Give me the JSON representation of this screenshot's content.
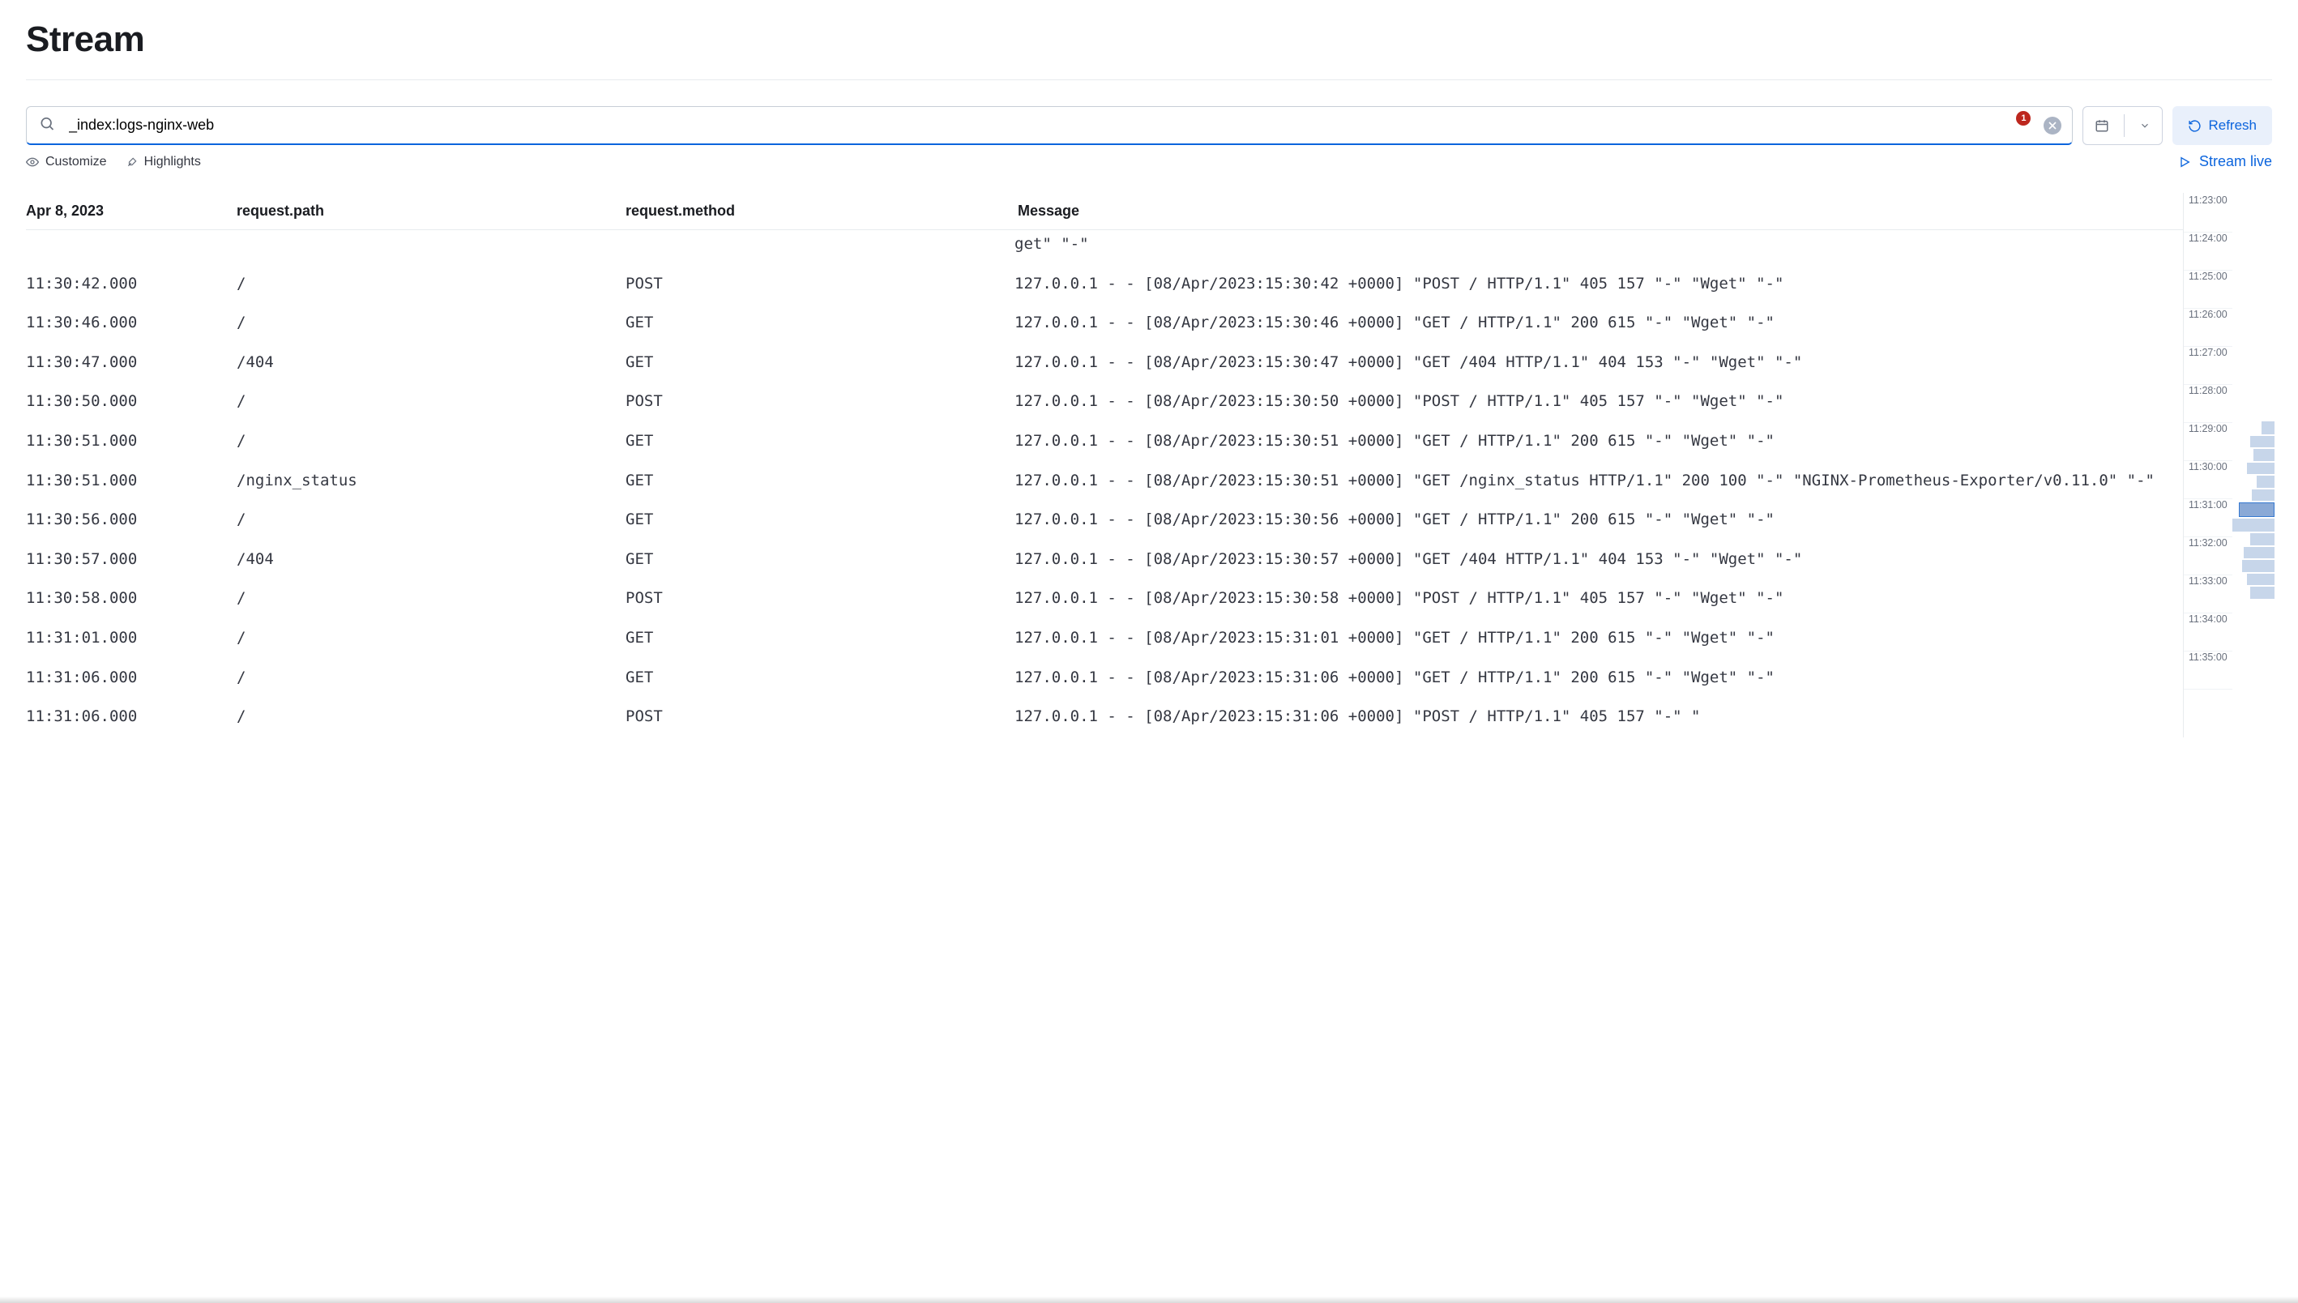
{
  "header": {
    "title": "Stream"
  },
  "search": {
    "value": "_index:logs-nginx-web",
    "badge_count": "1"
  },
  "actions": {
    "refresh_label": "Refresh",
    "customize_label": "Customize",
    "highlights_label": "Highlights",
    "stream_live_label": "Stream live"
  },
  "columns": {
    "date": "Apr 8, 2023",
    "path": "request.path",
    "method": "request.method",
    "message": "Message"
  },
  "rows": [
    {
      "ts": "",
      "path": "",
      "method": "",
      "msg": "get\" \"-\"",
      "cutoff": true
    },
    {
      "ts": "11:30:42.000",
      "path": "/",
      "method": "POST",
      "msg": "127.0.0.1 - - [08/Apr/2023:15:30:42 +0000] \"POST / HTTP/1.1\" 405 157 \"-\" \"Wget\" \"-\""
    },
    {
      "ts": "11:30:46.000",
      "path": "/",
      "method": "GET",
      "msg": "127.0.0.1 - - [08/Apr/2023:15:30:46 +0000] \"GET / HTTP/1.1\" 200 615 \"-\" \"Wget\" \"-\""
    },
    {
      "ts": "11:30:47.000",
      "path": "/404",
      "method": "GET",
      "msg": "127.0.0.1 - - [08/Apr/2023:15:30:47 +0000] \"GET /404 HTTP/1.1\" 404 153 \"-\" \"Wget\" \"-\""
    },
    {
      "ts": "11:30:50.000",
      "path": "/",
      "method": "POST",
      "msg": "127.0.0.1 - - [08/Apr/2023:15:30:50 +0000] \"POST / HTTP/1.1\" 405 157 \"-\" \"Wget\" \"-\""
    },
    {
      "ts": "11:30:51.000",
      "path": "/",
      "method": "GET",
      "msg": "127.0.0.1 - - [08/Apr/2023:15:30:51 +0000] \"GET / HTTP/1.1\" 200 615 \"-\" \"Wget\" \"-\""
    },
    {
      "ts": "11:30:51.000",
      "path": "/nginx_status",
      "method": "GET",
      "msg": "127.0.0.1 - - [08/Apr/2023:15:30:51 +0000] \"GET /nginx_status HTTP/1.1\" 200 100 \"-\" \"NGINX-Prometheus-Exporter/v0.11.0\" \"-\""
    },
    {
      "ts": "11:30:56.000",
      "path": "/",
      "method": "GET",
      "msg": "127.0.0.1 - - [08/Apr/2023:15:30:56 +0000] \"GET / HTTP/1.1\" 200 615 \"-\" \"Wget\" \"-\""
    },
    {
      "ts": "11:30:57.000",
      "path": "/404",
      "method": "GET",
      "msg": "127.0.0.1 - - [08/Apr/2023:15:30:57 +0000] \"GET /404 HTTP/1.1\" 404 153 \"-\" \"Wget\" \"-\""
    },
    {
      "ts": "11:30:58.000",
      "path": "/",
      "method": "POST",
      "msg": "127.0.0.1 - - [08/Apr/2023:15:30:58 +0000] \"POST / HTTP/1.1\" 405 157 \"-\" \"Wget\" \"-\""
    },
    {
      "ts": "11:31:01.000",
      "path": "/",
      "method": "GET",
      "msg": "127.0.0.1 - - [08/Apr/2023:15:31:01 +0000] \"GET / HTTP/1.1\" 200 615 \"-\" \"Wget\" \"-\""
    },
    {
      "ts": "11:31:06.000",
      "path": "/",
      "method": "GET",
      "msg": "127.0.0.1 - - [08/Apr/2023:15:31:06 +0000] \"GET / HTTP/1.1\" 200 615 \"-\" \"Wget\" \"-\""
    },
    {
      "ts": "11:31:06.000",
      "path": "/",
      "method": "POST",
      "msg": "127.0.0.1 - - [08/Apr/2023:15:31:06 +0000] \"POST / HTTP/1.1\" 405 157 \"-\" \""
    }
  ],
  "timeline": {
    "ticks": [
      "11:23:00",
      "11:24:00",
      "11:25:00",
      "11:26:00",
      "11:27:00",
      "11:28:00",
      "11:29:00",
      "11:30:00",
      "11:31:00",
      "11:32:00",
      "11:33:00",
      "11:34:00",
      "11:35:00"
    ],
    "spark": [
      {
        "w": 16,
        "h": 16,
        "hl": false
      },
      {
        "w": 30,
        "h": 14,
        "hl": false
      },
      {
        "w": 26,
        "h": 15,
        "hl": false
      },
      {
        "w": 34,
        "h": 14,
        "hl": false
      },
      {
        "w": 22,
        "h": 15,
        "hl": false
      },
      {
        "w": 28,
        "h": 14,
        "hl": false
      },
      {
        "w": 44,
        "h": 18,
        "hl": true
      },
      {
        "w": 52,
        "h": 16,
        "hl": false
      },
      {
        "w": 30,
        "h": 15,
        "hl": false
      },
      {
        "w": 38,
        "h": 14,
        "hl": false
      },
      {
        "w": 40,
        "h": 15,
        "hl": false
      },
      {
        "w": 34,
        "h": 14,
        "hl": false
      },
      {
        "w": 30,
        "h": 15,
        "hl": false
      }
    ]
  }
}
